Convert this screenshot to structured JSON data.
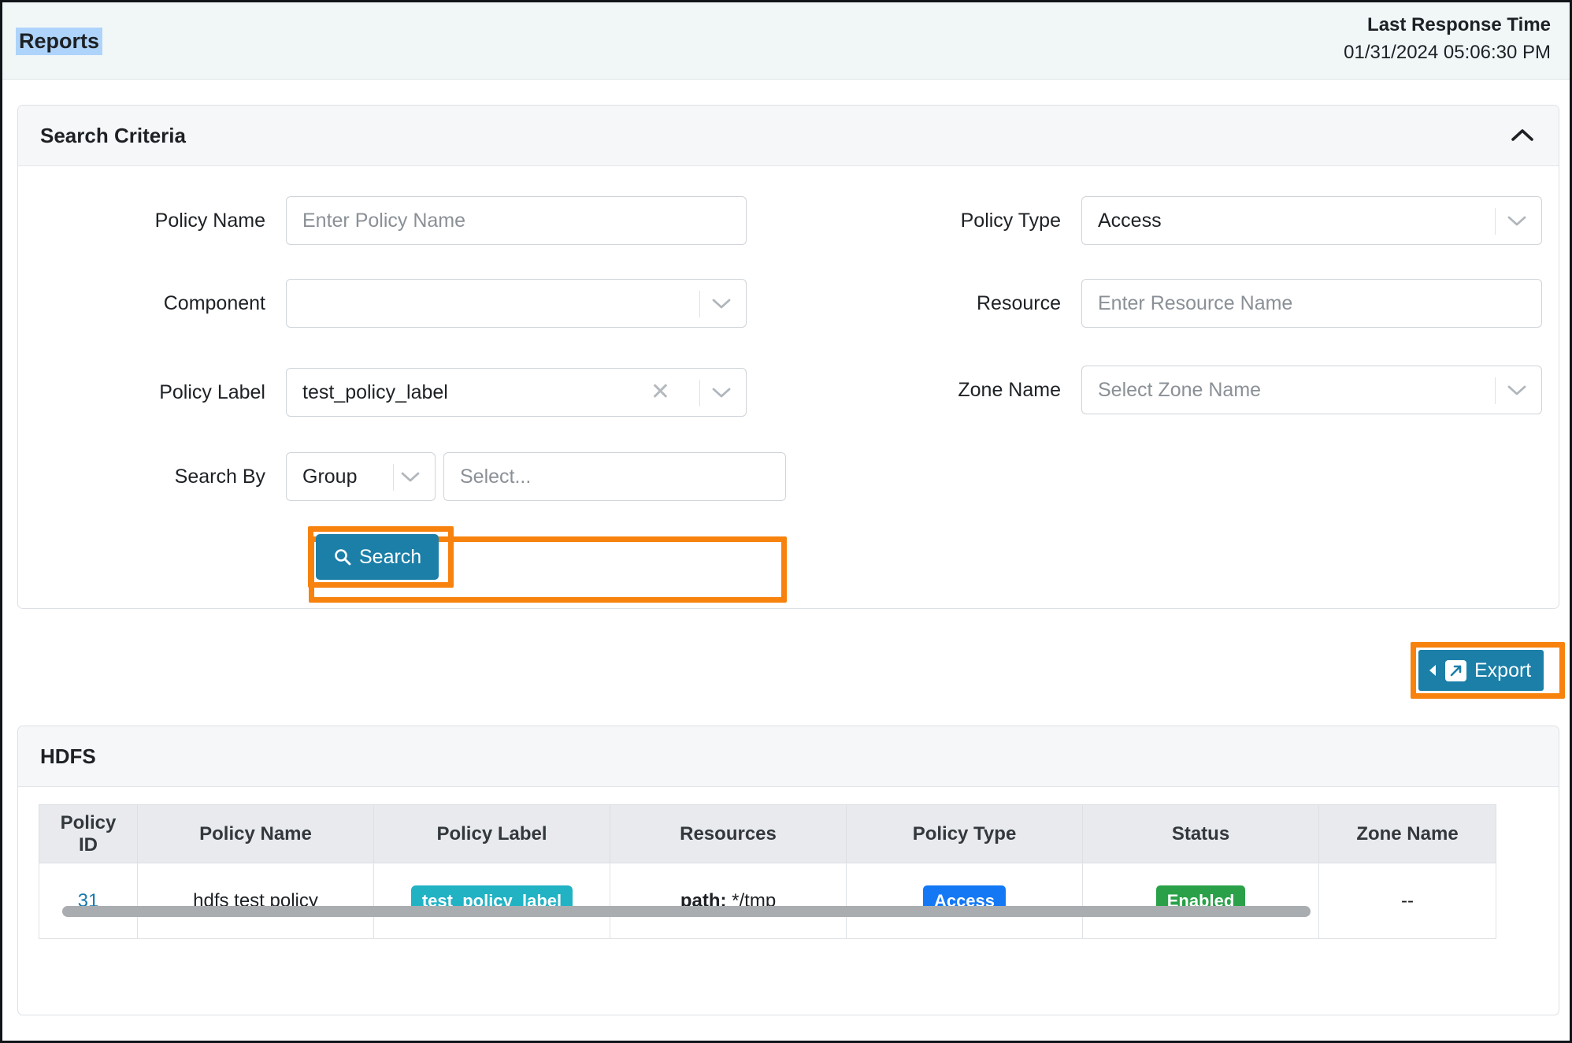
{
  "header": {
    "title": "Reports",
    "response_label": "Last Response Time",
    "response_value": "01/31/2024 05:06:30 PM"
  },
  "search_criteria": {
    "section_title": "Search Criteria",
    "collapse_icon": "chevron-up-icon",
    "fields": {
      "policy_name": {
        "label": "Policy Name",
        "value": "",
        "placeholder": "Enter Policy Name"
      },
      "component": {
        "label": "Component",
        "value": "",
        "placeholder": ""
      },
      "policy_label": {
        "label": "Policy Label",
        "value": "test_policy_label",
        "clear_icon": "close-icon",
        "highlighted": true
      },
      "search_by": {
        "label": "Search By",
        "selector_value": "Group",
        "value_placeholder": "Select..."
      },
      "policy_type": {
        "label": "Policy Type",
        "value": "Access",
        "placeholder": ""
      },
      "resource": {
        "label": "Resource",
        "value": "",
        "placeholder": "Enter Resource Name"
      },
      "zone_name": {
        "label": "Zone Name",
        "value": "",
        "placeholder": "Select Zone Name"
      }
    },
    "search_button": {
      "label": "Search",
      "icon": "search-icon",
      "highlighted": true
    }
  },
  "export_button": {
    "label": "Export",
    "icon": "external-link-icon",
    "caret_icon": "caret-left-icon",
    "highlighted": true
  },
  "results": {
    "section_title": "HDFS",
    "columns": [
      "Policy ID",
      "Policy Name",
      "Policy Label",
      "Resources",
      "Policy Type",
      "Status",
      "Zone Name"
    ],
    "rows": [
      {
        "policy_id": "31",
        "policy_name": "hdfs test policy",
        "policy_label": "test_policy_label",
        "resource_key": "path:",
        "resource_value": "*/tmp",
        "policy_type": "Access",
        "status": "Enabled",
        "zone_name": "--"
      }
    ]
  },
  "colors": {
    "accent_blue": "#1b7fa8",
    "highlight_orange": "#f7820d",
    "badge_teal": "#21b2c4",
    "badge_access_blue": "#1478f5",
    "badge_enabled_green": "#2aa148",
    "link_blue": "#1879ad",
    "header_band": "#f1f7f7",
    "title_selection": "#aed4fb"
  }
}
